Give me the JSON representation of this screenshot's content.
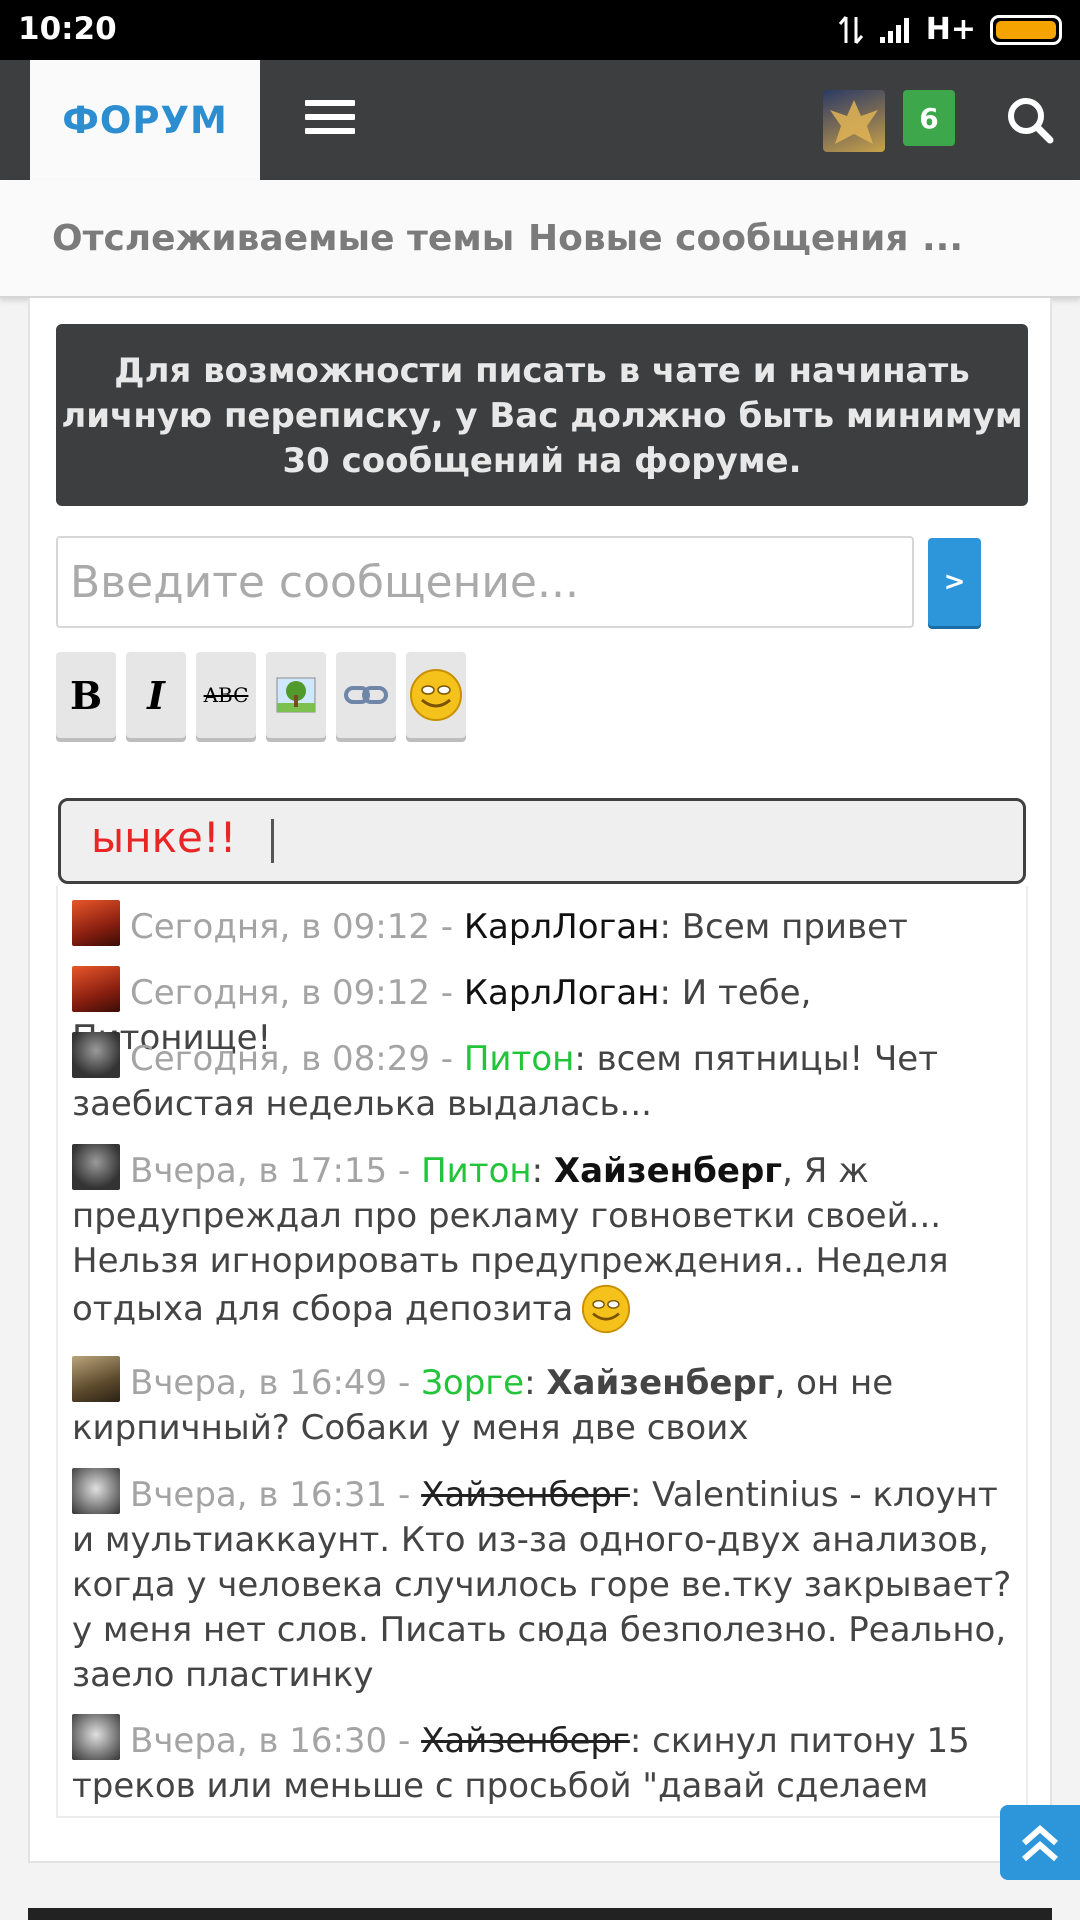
{
  "status_bar": {
    "time": "10:20",
    "network": "H+"
  },
  "nav": {
    "forum_label": "ФОРУМ",
    "notification_count": "6"
  },
  "subnav": {
    "tabs": [
      "Отслеживаемые темы",
      "Новые сообщения",
      "..."
    ]
  },
  "notice": {
    "text": "Для возможности писать в чате и начинать личную переписку, у Вас должно быть минимум 30 сообщений на форуме."
  },
  "chat_input": {
    "placeholder": "Введите сообщение...",
    "send_label": ">"
  },
  "toolbar": {
    "buttons": [
      "bold",
      "italic",
      "strikethrough",
      "image",
      "link",
      "smiley"
    ],
    "bold_glyph": "B",
    "italic_glyph": "I",
    "strike_glyph": "ABC"
  },
  "ticker": {
    "text": "ынке!!"
  },
  "messages": [
    {
      "time": "Сегодня, в 09:12 -",
      "user": "КарлЛоган",
      "sep": ":",
      "text": " Всем привет"
    },
    {
      "time": "Сегодня, в 09:12 -",
      "user": "КарлЛоган",
      "sep": ":",
      "text": " И тебе, Питонище!"
    },
    {
      "time": "Сегодня, в 08:29 -",
      "user": "Питон",
      "sep": ":",
      "text": " всем пятницы! Чет заебистая неделька выдалась..."
    },
    {
      "time": "Вчера, в 17:15 -",
      "user": "Питон",
      "sep": ":",
      "mention": "Хайзенберг",
      "text": ", Я ж предупреждал про рекламу говноветки своей... Нельзя игнорировать предупреждения.. Неделя отдыха для сбора депозита"
    },
    {
      "time": "Вчера, в 16:49 -",
      "user": "Зорге",
      "sep": ":",
      "mention": "Хайзенберг",
      "text": ", он не кирпичный? Собаки у меня две своих"
    },
    {
      "time": "Вчера, в 16:31 -",
      "user": "Хайзенберг",
      "sep": ":",
      "text": " Valentinius - клоунт и мультиаккаунт. Кто из-за одного-двух анализов, когда у человека случилось горе ве.тку закрывает? у меня нет слов. Писать сюда безполезно. Реально, заело пластинку"
    },
    {
      "time": "Вчера, в 16:30 -",
      "user": "Хайзенберг",
      "sep": ":",
      "text": " скинул питону 15 треков или меньше с просьбой \"давай сделаем"
    }
  ],
  "colors": {
    "accent": "#2d95d9",
    "nav_bg": "#3d3e40",
    "badge": "#3ca84b",
    "user_green": "#22c53a",
    "ticker_red": "#ea2525"
  }
}
